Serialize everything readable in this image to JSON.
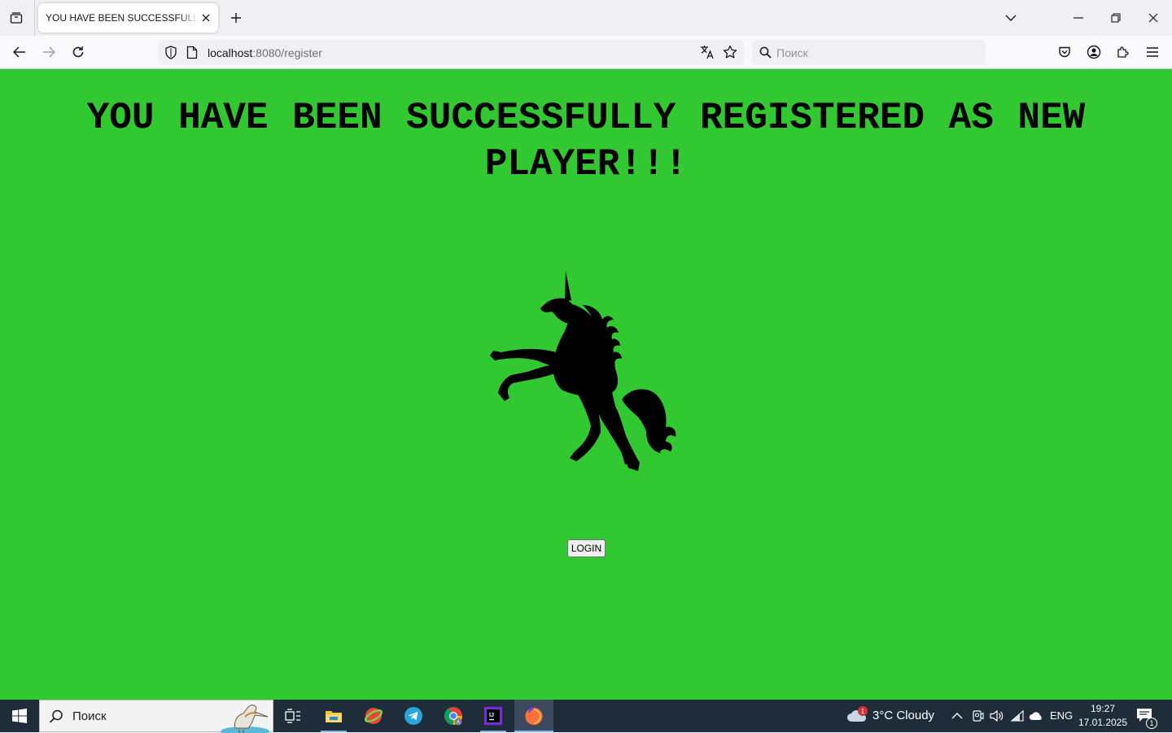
{
  "browser": {
    "tab": {
      "title": "YOU HAVE BEEN SUCCESSFULLY REGISTERED AS NEW PLAYER!!!"
    },
    "url": {
      "host": "localhost",
      "rest": ":8080/register"
    },
    "search": {
      "placeholder": "Поиск"
    }
  },
  "page": {
    "heading": "YOU HAVE BEEN SUCCESSFULLY REGISTERED AS NEW PLAYER!!!",
    "image": "unicorn-silhouette",
    "login_label": "LOGIN",
    "background_color": "#32c832"
  },
  "taskbar": {
    "search_text": "Поиск",
    "apps": [
      "file-explorer-icon",
      "opera-icon",
      "telegram-icon",
      "chrome-icon",
      "intellij-icon",
      "firefox-icon"
    ],
    "weather": {
      "badge": "1",
      "text": "3°C  Cloudy"
    },
    "lang": "ENG",
    "time": "19:27",
    "date": "17.01.2025",
    "notifications": "1"
  }
}
